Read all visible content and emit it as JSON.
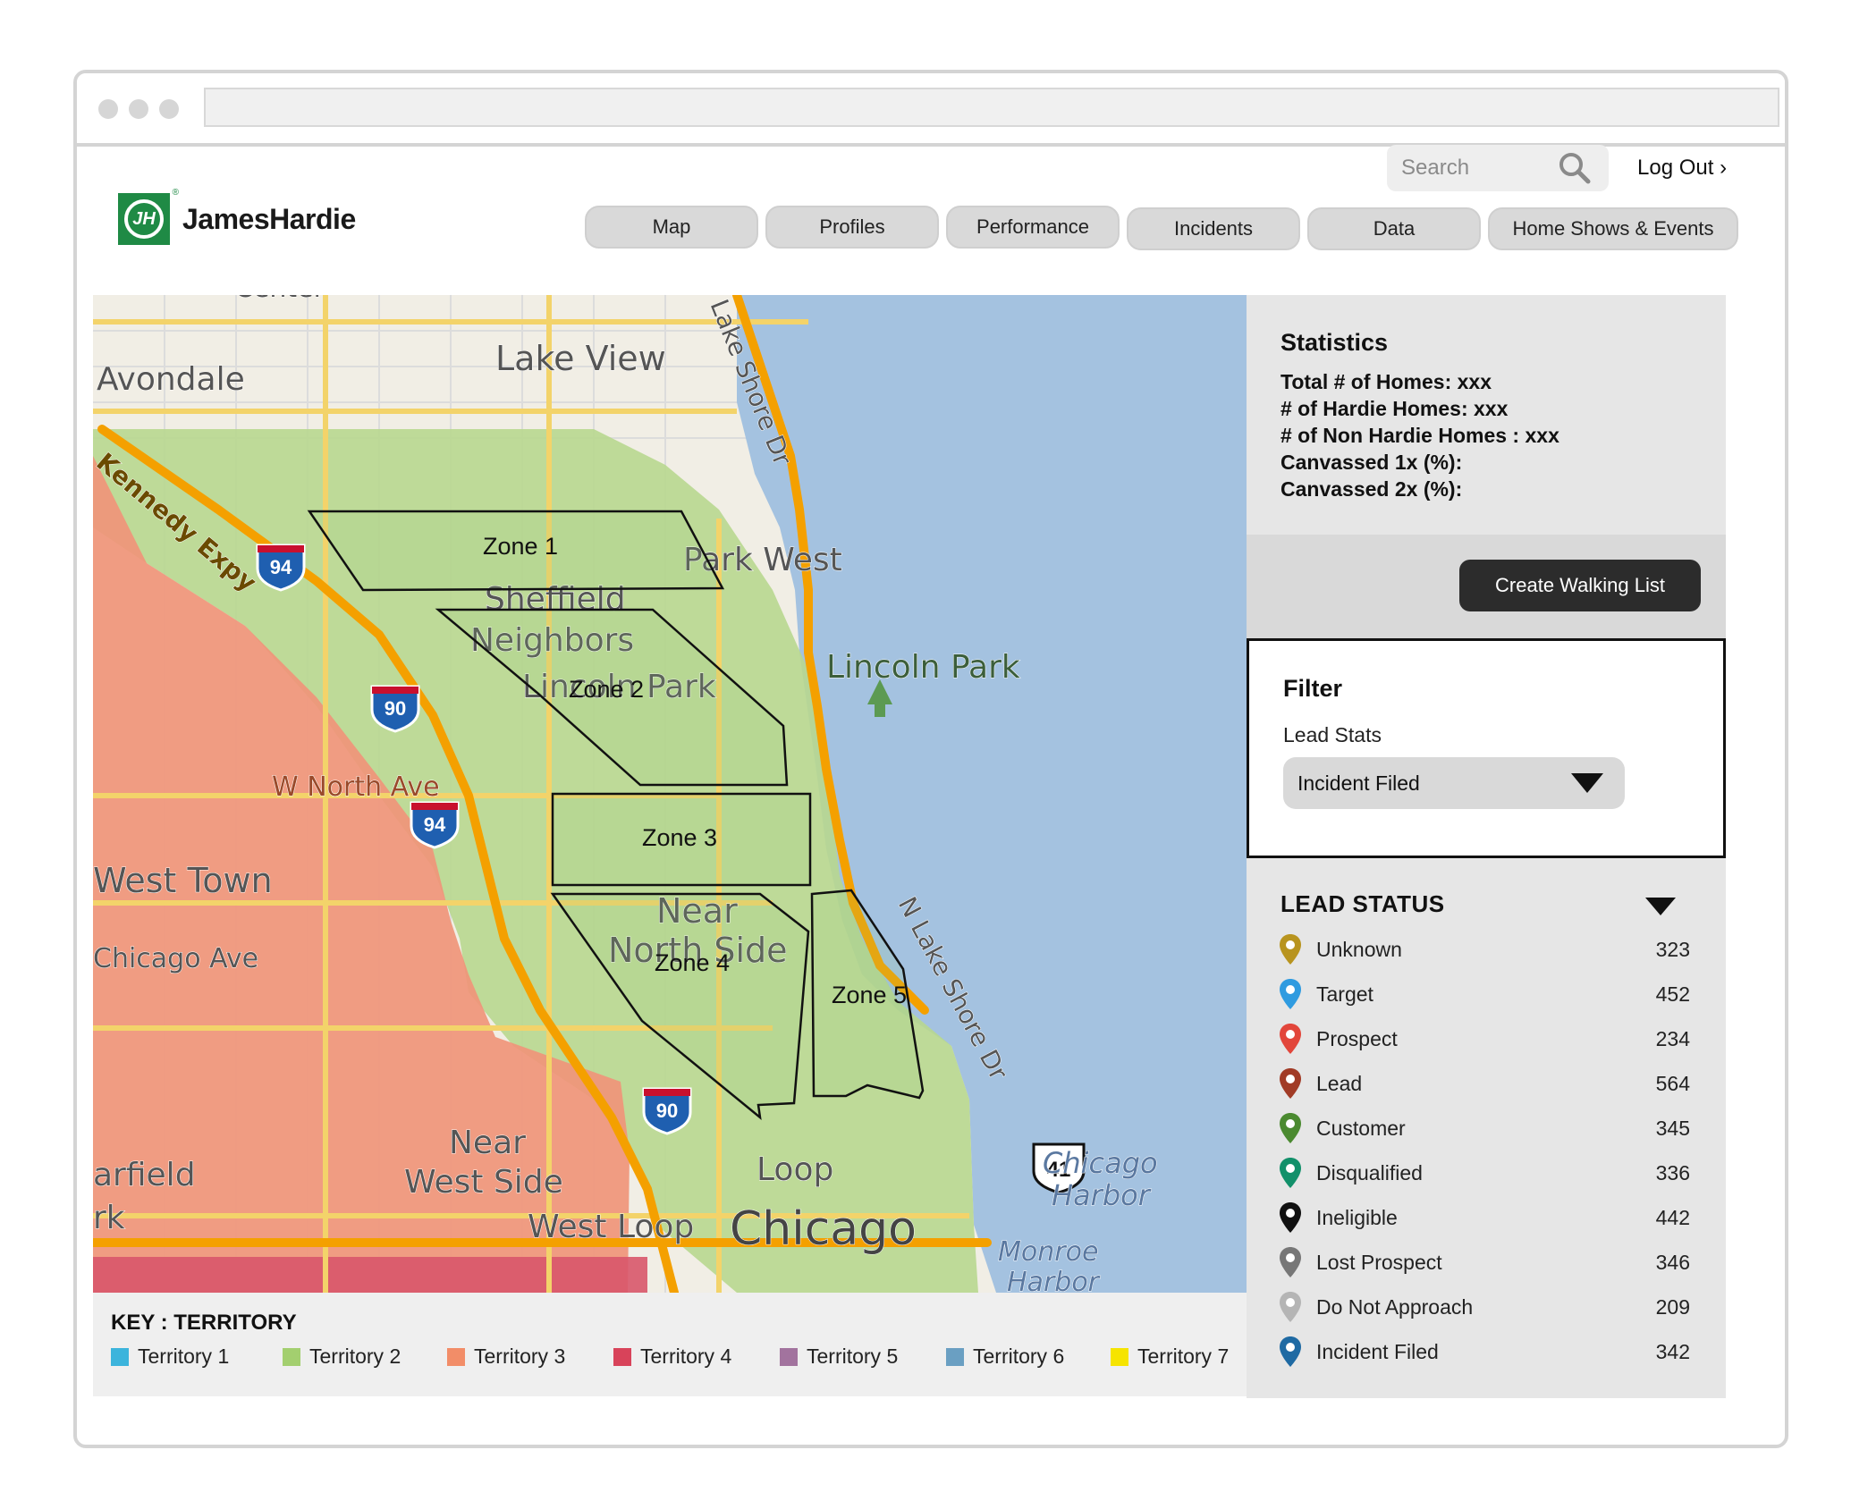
{
  "brand": {
    "name": "JamesHardie",
    "mark": "JH",
    "reg": "®",
    "color": "#1f8a45"
  },
  "header": {
    "search_placeholder": "Search",
    "logout": "Log Out ›"
  },
  "nav": [
    "Map",
    "Profiles",
    "Performance",
    "Incidents",
    "Data",
    "Home Shows & Events"
  ],
  "map": {
    "places": [
      "Center",
      "Lake View",
      "Avondale",
      "Lake Shore Dr",
      "Kennedy Expy",
      "Park West",
      "Sheffield",
      "Neighbors",
      "Lincoln Park",
      "Lincoln Park",
      "W North Ave",
      "West Town",
      "Chicago Ave",
      "Near",
      "North Side",
      "N Lake Shore Dr",
      "Near",
      "West Side",
      "arfield",
      "rk",
      "Loop",
      "West Loop",
      "Chicago",
      "Chicago",
      "Harbor",
      "Monroe",
      "Harbor"
    ],
    "highways": [
      "94",
      "90",
      "94",
      "90",
      "41"
    ],
    "zones": [
      "Zone 1",
      "Zone 2",
      "Zone 3",
      "Zone 4",
      "Zone 5"
    ]
  },
  "key": {
    "title": "KEY : TERRITORY",
    "items": [
      {
        "label": "Territory 1",
        "color": "#3cb4dc"
      },
      {
        "label": "Territory 2",
        "color": "#a3cf6f"
      },
      {
        "label": "Territory 3",
        "color": "#f28d68"
      },
      {
        "label": "Territory 4",
        "color": "#d8435a"
      },
      {
        "label": "Territory 5",
        "color": "#a2739e"
      },
      {
        "label": "Territory 6",
        "color": "#6a9fc2"
      },
      {
        "label": "Territory 7",
        "color": "#f6e400"
      }
    ]
  },
  "statistics": {
    "title": "Statistics",
    "lines": [
      "Total # of Homes: xxx",
      "# of Hardie Homes: xxx",
      "# of Non Hardie Homes : xxx",
      "Canvassed 1x (%):",
      "Canvassed 2x (%):"
    ]
  },
  "walking_list_button": "Create Walking List",
  "filter": {
    "title": "Filter",
    "label": "Lead Stats",
    "selected": "Incident Filed"
  },
  "lead_status": {
    "title": "LEAD STATUS",
    "items": [
      {
        "label": "Unknown",
        "count": "323",
        "color": "#b8941f"
      },
      {
        "label": "Target",
        "count": "452",
        "color": "#2f9be0"
      },
      {
        "label": "Prospect",
        "count": "234",
        "color": "#e2463b"
      },
      {
        "label": "Lead",
        "count": "564",
        "color": "#a13b26"
      },
      {
        "label": "Customer",
        "count": "345",
        "color": "#4b8a30"
      },
      {
        "label": "Disqualified",
        "count": "336",
        "color": "#12906a"
      },
      {
        "label": "Ineligible",
        "count": "442",
        "color": "#111111"
      },
      {
        "label": "Lost Prospect",
        "count": "346",
        "color": "#777777"
      },
      {
        "label": "Do Not Approach",
        "count": "209",
        "color": "#b5b5b5"
      },
      {
        "label": "Incident Filed",
        "count": "342",
        "color": "#1f6aa3"
      }
    ]
  }
}
